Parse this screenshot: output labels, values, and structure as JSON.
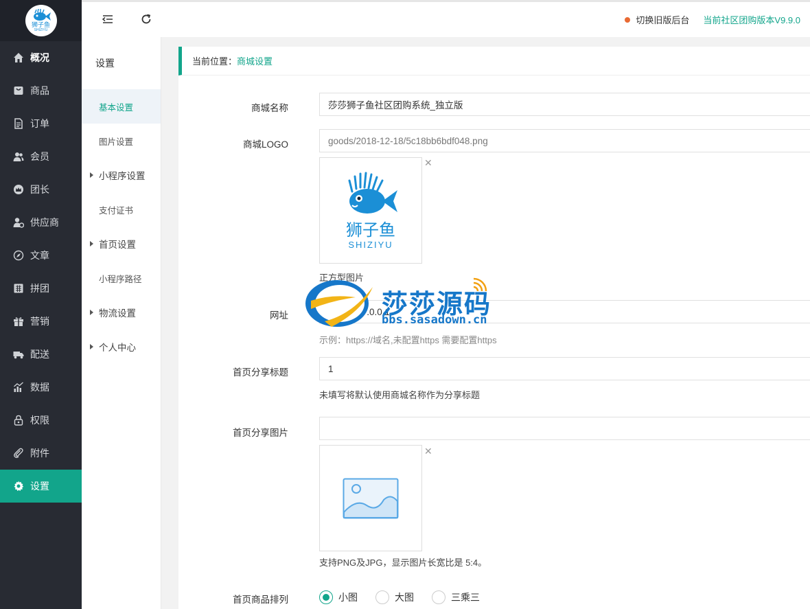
{
  "logo": {
    "cn": "狮子鱼",
    "en": "SHIZIYU"
  },
  "sidebar": {
    "items": [
      {
        "label": "概况",
        "icon": "home-icon"
      },
      {
        "label": "商品",
        "icon": "bag-icon"
      },
      {
        "label": "订单",
        "icon": "document-icon"
      },
      {
        "label": "会员",
        "icon": "users-icon"
      },
      {
        "label": "团长",
        "icon": "crown-icon"
      },
      {
        "label": "供应商",
        "icon": "supplier-icon"
      },
      {
        "label": "文章",
        "icon": "compass-icon"
      },
      {
        "label": "拼团",
        "icon": "group-buy-icon"
      },
      {
        "label": "营销",
        "icon": "gift-icon"
      },
      {
        "label": "配送",
        "icon": "truck-icon"
      },
      {
        "label": "数据",
        "icon": "chart-icon"
      },
      {
        "label": "权限",
        "icon": "lock-icon"
      },
      {
        "label": "附件",
        "icon": "paperclip-icon"
      },
      {
        "label": "设置",
        "icon": "gear-icon"
      }
    ]
  },
  "topbar": {
    "switch_old": "切换旧版后台",
    "version": "当前社区团购版本V9.9.0"
  },
  "subnav": {
    "title": "设置",
    "items": [
      {
        "label": "基本设置"
      },
      {
        "label": "图片设置"
      },
      {
        "label": "小程序设置"
      },
      {
        "label": "支付证书"
      },
      {
        "label": "首页设置"
      },
      {
        "label": "小程序路径"
      },
      {
        "label": "物流设置"
      },
      {
        "label": "个人中心"
      }
    ]
  },
  "breadcrumb": {
    "prefix": "当前位置：",
    "current": "商城设置"
  },
  "form": {
    "shop_name": {
      "label": "商城名称",
      "value": "莎莎狮子鱼社区团购系统_独立版"
    },
    "shop_logo": {
      "label": "商城LOGO",
      "value": "goods/2018-12-18/5c18bb6bdf048.png",
      "caption": "正方型图片"
    },
    "url": {
      "label": "网址",
      "value": "http://127.0.0.1",
      "hint": "示例：https://域名,未配置https 需要配置https"
    },
    "share_title": {
      "label": "首页分享标题",
      "value": "1",
      "hint": "未填写将默认使用商城名称作为分享标题"
    },
    "share_image": {
      "label": "首页分享图片",
      "value": "",
      "hint": "支持PNG及JPG，显示图片长宽比是 5:4。"
    },
    "goods_layout": {
      "label": "首页商品排列",
      "options": [
        "小图",
        "大图",
        "三乘三"
      ],
      "selected": 0
    }
  },
  "watermark": {
    "cn": "莎莎源码",
    "url": "bbs.sasadown.cn"
  },
  "colors": {
    "accent": "#12a58b",
    "sidebar_bg": "#282b33",
    "brand_blue": "#1b8fd6",
    "dot": "#e96a33"
  }
}
